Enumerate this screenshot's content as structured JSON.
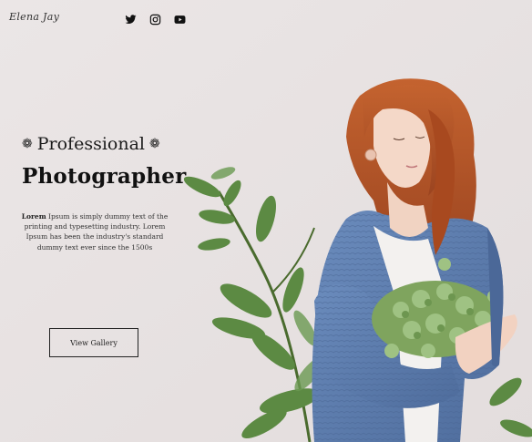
{
  "brand": {
    "logo_text": "Elena Jay"
  },
  "social": {
    "icons": [
      "twitter-icon",
      "instagram-icon",
      "youtube-icon"
    ]
  },
  "hero": {
    "subtitle": "Professional",
    "title": "Photographer",
    "description_lead": "Lorem",
    "description_rest": " Ipsum is simply dummy text of the printing and typesetting industry. Lorem Ipsum has been the industry's standard dummy text ever since the 1500s",
    "button_label": "View Gallery"
  },
  "colors": {
    "background": "#e8e3e3",
    "text": "#111111",
    "sweater": "#5f7fb0",
    "hair": "#b4542a",
    "leaf": "#4f7a3c"
  }
}
